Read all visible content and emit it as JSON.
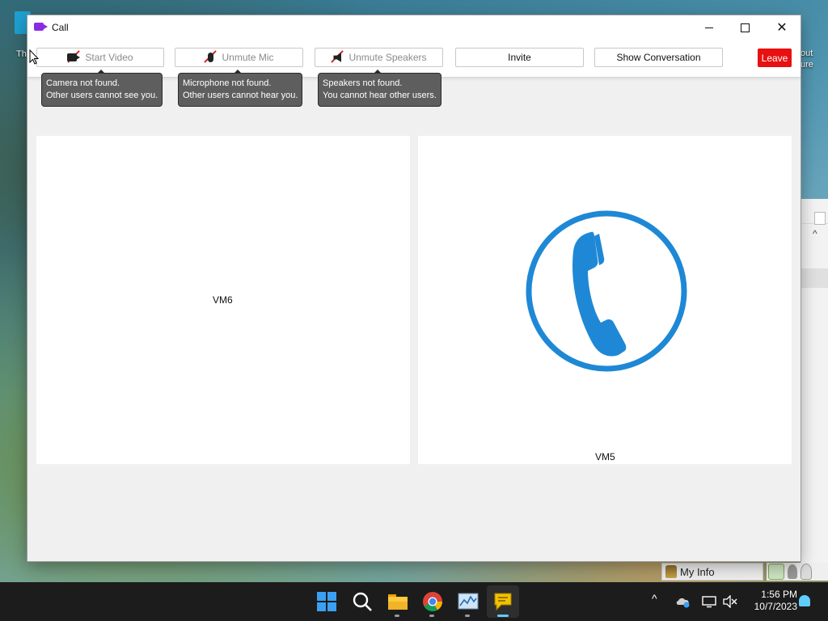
{
  "desktop": {
    "left_icon_label": "Th",
    "right_text_line1": "out",
    "right_text_line2": "ure"
  },
  "window": {
    "title": "Call",
    "controls": {
      "minimize": "minimize",
      "maximize": "maximize",
      "close": "close"
    }
  },
  "toolbar": {
    "start_video": "Start Video",
    "unmute_mic": "Unmute Mic",
    "unmute_speakers": "Unmute Speakers",
    "invite": "Invite",
    "show_conversation": "Show Conversation",
    "leave": "Leave"
  },
  "tooltips": {
    "camera": {
      "line1": "Camera not found.",
      "line2": "Other users cannot see you."
    },
    "microphone": {
      "line1": "Microphone not found.",
      "line2": "Other users cannot hear you."
    },
    "speakers": {
      "line1": "Speakers not found.",
      "line2": "You cannot hear other users."
    }
  },
  "participants": [
    {
      "name": "VM6",
      "avatar": "none"
    },
    {
      "name": "VM5",
      "avatar": "phone-icon"
    }
  ],
  "background_app": {
    "my_info": "My Info"
  },
  "taskbar": {
    "apps": [
      "start-icon",
      "search-icon",
      "file-explorer-icon",
      "chrome-icon",
      "resource-monitor-icon",
      "chat-app-icon"
    ],
    "active_app": "chat-app-icon",
    "tray": [
      "chevron-up-icon",
      "onedrive-icon",
      "display-icon",
      "volume-muted-icon"
    ],
    "time": "1:56 PM",
    "date": "10/7/2023"
  },
  "colors": {
    "leave_button": "#e81010",
    "phone_icon": "#1e88d6",
    "tooltip_bg": "#5e5e5e",
    "taskbar_bg": "#1c1c1c",
    "accent": "#60cdff"
  }
}
